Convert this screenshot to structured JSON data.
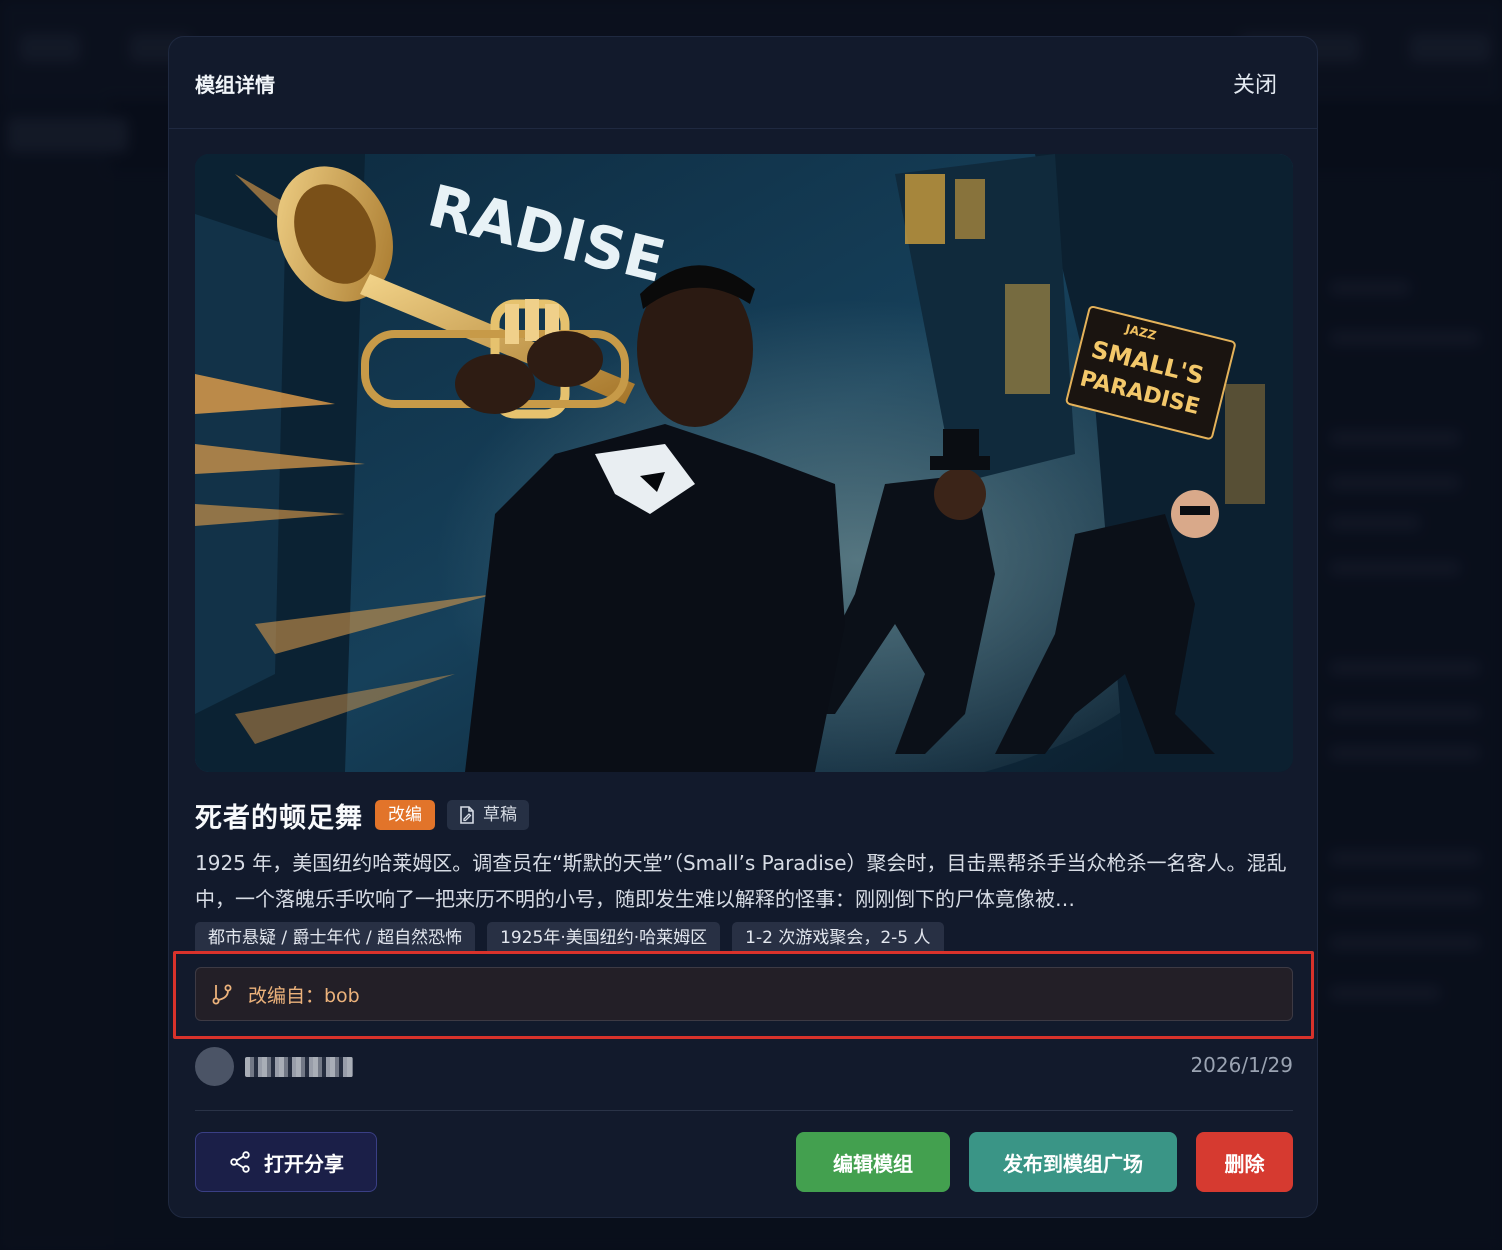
{
  "background": {
    "nav_items": [
      "广场",
      "我的",
      "帮助"
    ]
  },
  "modal": {
    "title": "模组详情",
    "close_label": "关闭"
  },
  "module": {
    "title": "死者的顿足舞",
    "badge_adapted": "改编",
    "badge_draft": "草稿",
    "description": "1925 年，美国纽约哈莱姆区。调查员在“斯默的天堂”（Small’s Paradise）聚会时，目击黑帮杀手当众枪杀一名客人。混乱中，一个落魄乐手吹响了一把来历不明的小号，随即发生难以解释的怪事：刚刚倒下的尸体竟像被…",
    "tags": [
      "都市悬疑 / 爵士年代 / 超自然恐怖",
      "1925年·美国纽约·哈莱姆区",
      "1-2 次游戏聚会，2-5 人"
    ],
    "adapted_from": "改编自：bob",
    "date": "2026/1/29"
  },
  "cover": {
    "sign_top": "RADISE",
    "sign_right_small": "JAZZ",
    "sign_right_line1": "SMALL'S",
    "sign_right_line2": "PARADISE"
  },
  "actions": {
    "share": "打开分享",
    "edit": "编辑模组",
    "publish": "发布到模组广场",
    "delete": "删除"
  },
  "icons": {
    "draft": "file-draft-icon",
    "branch": "git-branch-icon",
    "share": "share-icon"
  },
  "colors": {
    "adapted_badge": "#e2742a",
    "edit_button": "#43a04f",
    "publish_button": "#3a9586",
    "delete_button": "#d63a30",
    "highlight_frame": "#d8322b",
    "source_text": "#ecb27b"
  }
}
